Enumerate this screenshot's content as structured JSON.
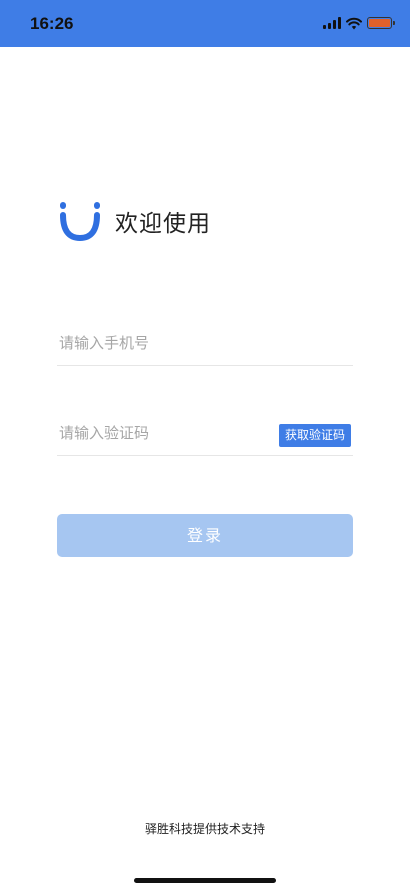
{
  "status_bar": {
    "time": "16:26",
    "background_color": "#3f7de6",
    "icons": [
      "signal-icon",
      "wifi-icon",
      "battery-icon"
    ],
    "battery_color": "#e0612b"
  },
  "header": {
    "logo_icon": "smile-logo-icon",
    "welcome_text": "欢迎使用"
  },
  "form": {
    "phone_placeholder": "请输入手机号",
    "phone_value": "",
    "code_placeholder": "请输入验证码",
    "code_value": "",
    "get_code_label": "获取验证码",
    "login_label": "登录",
    "accent_color": "#3f7de6",
    "login_button_color": "#a6c6f1"
  },
  "footer": {
    "text": "驿胜科技提供技术支持"
  }
}
